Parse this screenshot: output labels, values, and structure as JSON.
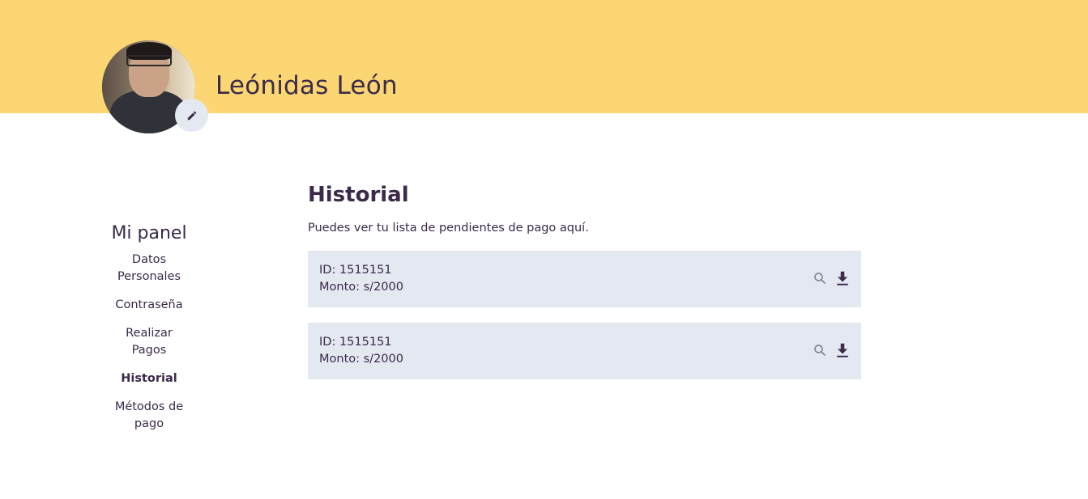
{
  "header": {
    "user_name": "Leónidas León",
    "edit_icon": "pencil-icon",
    "banner_color": "#fbd672"
  },
  "sidebar": {
    "title": "Mi panel",
    "items": [
      {
        "label": "Datos Personales",
        "active": false
      },
      {
        "label": "Contraseña",
        "active": false
      },
      {
        "label": "Realizar Pagos",
        "active": false
      },
      {
        "label": "Historial",
        "active": true
      },
      {
        "label": "Métodos de pago",
        "active": false
      }
    ]
  },
  "main": {
    "title": "Historial",
    "description": "Puedes ver tu lista de pendientes de pago aquí.",
    "records": [
      {
        "id_text": "ID: 1515151",
        "amount_text": "Monto: s/2000"
      },
      {
        "id_text": "ID: 1515151",
        "amount_text": "Monto: s/2000"
      }
    ],
    "actions": {
      "view_icon": "search-icon",
      "download_icon": "download-icon"
    }
  },
  "colors": {
    "text": "#3b2a4a",
    "card_bg": "#e3e8f1",
    "search_icon": "#8a8494"
  }
}
